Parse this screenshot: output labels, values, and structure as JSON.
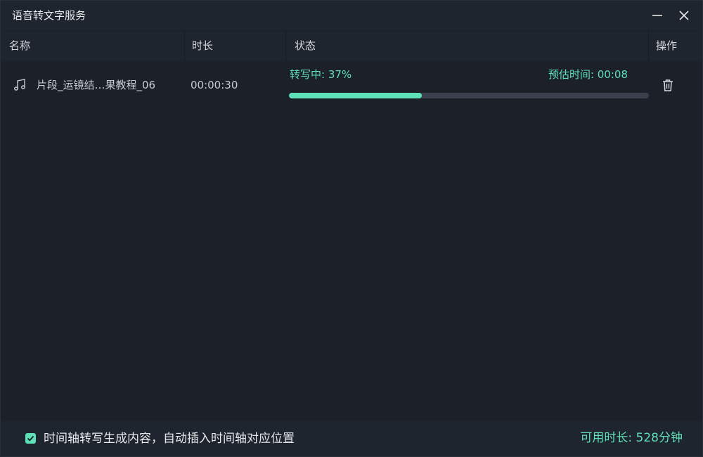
{
  "window": {
    "title": "语音转文字服务"
  },
  "table": {
    "headers": {
      "name": "名称",
      "duration": "时长",
      "status": "状态",
      "action": "操作"
    },
    "rows": [
      {
        "name": "片段_运镜结…果教程_06",
        "duration": "00:00:30",
        "status": "转写中: 37%",
        "eta": "预估时间: 00:08",
        "progress": 0.37,
        "icon": "music-note-icon"
      }
    ]
  },
  "footer": {
    "checkbox_checked": true,
    "checkbox_label": "时间轴转写生成内容，自动插入时间轴对应位置",
    "available": "可用时长: 528分钟"
  },
  "colors": {
    "accent": "#5ee0b8",
    "background": "#1b2029",
    "panel": "#1f252e"
  }
}
